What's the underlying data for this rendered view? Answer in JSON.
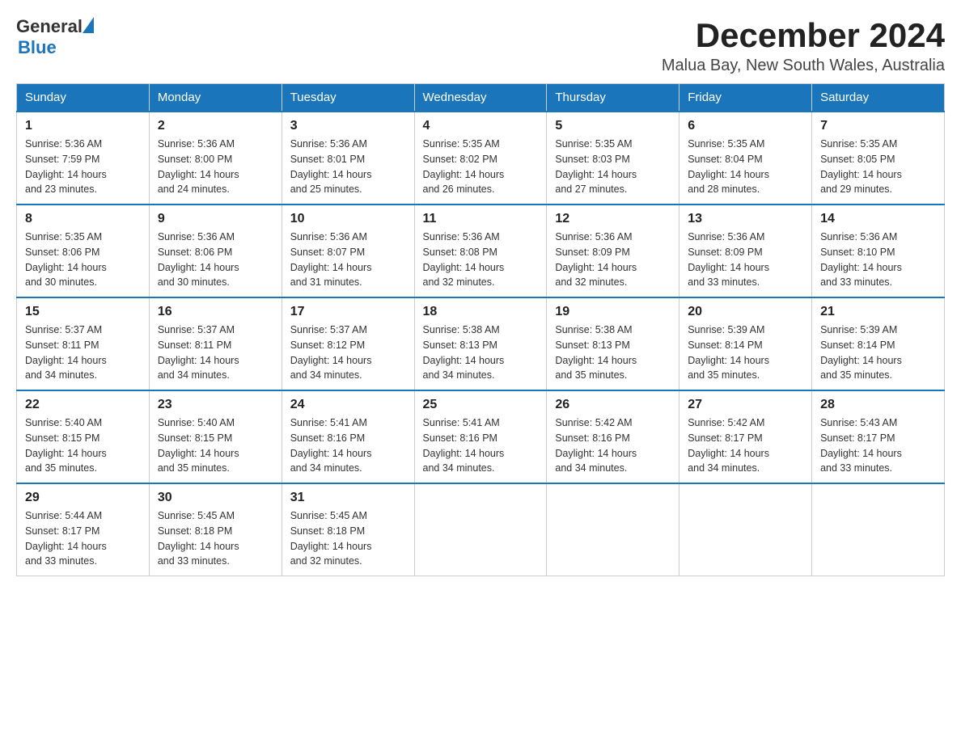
{
  "header": {
    "logo_general": "General",
    "logo_blue": "Blue",
    "month_year": "December 2024",
    "location": "Malua Bay, New South Wales, Australia"
  },
  "weekdays": [
    "Sunday",
    "Monday",
    "Tuesday",
    "Wednesday",
    "Thursday",
    "Friday",
    "Saturday"
  ],
  "weeks": [
    [
      {
        "day": "1",
        "info": "Sunrise: 5:36 AM\nSunset: 7:59 PM\nDaylight: 14 hours\nand 23 minutes."
      },
      {
        "day": "2",
        "info": "Sunrise: 5:36 AM\nSunset: 8:00 PM\nDaylight: 14 hours\nand 24 minutes."
      },
      {
        "day": "3",
        "info": "Sunrise: 5:36 AM\nSunset: 8:01 PM\nDaylight: 14 hours\nand 25 minutes."
      },
      {
        "day": "4",
        "info": "Sunrise: 5:35 AM\nSunset: 8:02 PM\nDaylight: 14 hours\nand 26 minutes."
      },
      {
        "day": "5",
        "info": "Sunrise: 5:35 AM\nSunset: 8:03 PM\nDaylight: 14 hours\nand 27 minutes."
      },
      {
        "day": "6",
        "info": "Sunrise: 5:35 AM\nSunset: 8:04 PM\nDaylight: 14 hours\nand 28 minutes."
      },
      {
        "day": "7",
        "info": "Sunrise: 5:35 AM\nSunset: 8:05 PM\nDaylight: 14 hours\nand 29 minutes."
      }
    ],
    [
      {
        "day": "8",
        "info": "Sunrise: 5:35 AM\nSunset: 8:06 PM\nDaylight: 14 hours\nand 30 minutes."
      },
      {
        "day": "9",
        "info": "Sunrise: 5:36 AM\nSunset: 8:06 PM\nDaylight: 14 hours\nand 30 minutes."
      },
      {
        "day": "10",
        "info": "Sunrise: 5:36 AM\nSunset: 8:07 PM\nDaylight: 14 hours\nand 31 minutes."
      },
      {
        "day": "11",
        "info": "Sunrise: 5:36 AM\nSunset: 8:08 PM\nDaylight: 14 hours\nand 32 minutes."
      },
      {
        "day": "12",
        "info": "Sunrise: 5:36 AM\nSunset: 8:09 PM\nDaylight: 14 hours\nand 32 minutes."
      },
      {
        "day": "13",
        "info": "Sunrise: 5:36 AM\nSunset: 8:09 PM\nDaylight: 14 hours\nand 33 minutes."
      },
      {
        "day": "14",
        "info": "Sunrise: 5:36 AM\nSunset: 8:10 PM\nDaylight: 14 hours\nand 33 minutes."
      }
    ],
    [
      {
        "day": "15",
        "info": "Sunrise: 5:37 AM\nSunset: 8:11 PM\nDaylight: 14 hours\nand 34 minutes."
      },
      {
        "day": "16",
        "info": "Sunrise: 5:37 AM\nSunset: 8:11 PM\nDaylight: 14 hours\nand 34 minutes."
      },
      {
        "day": "17",
        "info": "Sunrise: 5:37 AM\nSunset: 8:12 PM\nDaylight: 14 hours\nand 34 minutes."
      },
      {
        "day": "18",
        "info": "Sunrise: 5:38 AM\nSunset: 8:13 PM\nDaylight: 14 hours\nand 34 minutes."
      },
      {
        "day": "19",
        "info": "Sunrise: 5:38 AM\nSunset: 8:13 PM\nDaylight: 14 hours\nand 35 minutes."
      },
      {
        "day": "20",
        "info": "Sunrise: 5:39 AM\nSunset: 8:14 PM\nDaylight: 14 hours\nand 35 minutes."
      },
      {
        "day": "21",
        "info": "Sunrise: 5:39 AM\nSunset: 8:14 PM\nDaylight: 14 hours\nand 35 minutes."
      }
    ],
    [
      {
        "day": "22",
        "info": "Sunrise: 5:40 AM\nSunset: 8:15 PM\nDaylight: 14 hours\nand 35 minutes."
      },
      {
        "day": "23",
        "info": "Sunrise: 5:40 AM\nSunset: 8:15 PM\nDaylight: 14 hours\nand 35 minutes."
      },
      {
        "day": "24",
        "info": "Sunrise: 5:41 AM\nSunset: 8:16 PM\nDaylight: 14 hours\nand 34 minutes."
      },
      {
        "day": "25",
        "info": "Sunrise: 5:41 AM\nSunset: 8:16 PM\nDaylight: 14 hours\nand 34 minutes."
      },
      {
        "day": "26",
        "info": "Sunrise: 5:42 AM\nSunset: 8:16 PM\nDaylight: 14 hours\nand 34 minutes."
      },
      {
        "day": "27",
        "info": "Sunrise: 5:42 AM\nSunset: 8:17 PM\nDaylight: 14 hours\nand 34 minutes."
      },
      {
        "day": "28",
        "info": "Sunrise: 5:43 AM\nSunset: 8:17 PM\nDaylight: 14 hours\nand 33 minutes."
      }
    ],
    [
      {
        "day": "29",
        "info": "Sunrise: 5:44 AM\nSunset: 8:17 PM\nDaylight: 14 hours\nand 33 minutes."
      },
      {
        "day": "30",
        "info": "Sunrise: 5:45 AM\nSunset: 8:18 PM\nDaylight: 14 hours\nand 33 minutes."
      },
      {
        "day": "31",
        "info": "Sunrise: 5:45 AM\nSunset: 8:18 PM\nDaylight: 14 hours\nand 32 minutes."
      },
      {
        "day": "",
        "info": ""
      },
      {
        "day": "",
        "info": ""
      },
      {
        "day": "",
        "info": ""
      },
      {
        "day": "",
        "info": ""
      }
    ]
  ]
}
